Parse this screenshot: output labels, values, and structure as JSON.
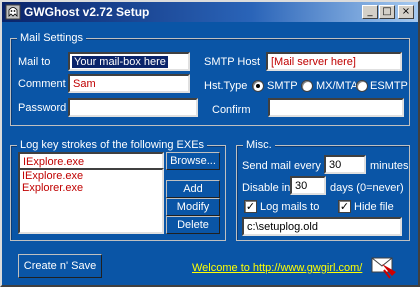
{
  "window": {
    "title": "GWGhost v2.72 Setup",
    "minimize_glyph": "_",
    "maximize_glyph": "□",
    "close_glyph": "×"
  },
  "mail_settings": {
    "legend": "Mail Settings",
    "mail_to_label": "Mail to",
    "mail_to_value": "Your mail-box here",
    "comment_label": "Comment",
    "comment_value": "Sam",
    "password_label": "Password",
    "password_value": "",
    "smtp_host_label": "SMTP Host",
    "smtp_host_value": "[Mail server here]",
    "host_type_label": "Hst.Type",
    "host_types": [
      {
        "label": "SMTP",
        "selected": true
      },
      {
        "label": "MX/MTA",
        "selected": false
      },
      {
        "label": "ESMTP",
        "selected": false
      }
    ],
    "confirm_label": "Confirm",
    "confirm_value": ""
  },
  "exe_group": {
    "legend": "Log key strokes of the following EXEs",
    "input_value": "IExplore.exe",
    "list_items": [
      "IExplore.exe",
      "Explorer.exe"
    ],
    "browse_label": "Browse...",
    "add_label": "Add",
    "modify_label": "Modify",
    "delete_label": "Delete"
  },
  "misc": {
    "legend": "Misc.",
    "send_every_label": "Send mail every",
    "send_every_value": "30",
    "send_every_unit": "minutes",
    "disable_label": "Disable in",
    "disable_value": "30",
    "disable_unit": "days (0=never)",
    "log_mails_label": "Log mails to",
    "log_mails_checked": true,
    "hide_file_label": "Hide file",
    "hide_file_checked": true,
    "log_path_value": "c:\\setuplog.old"
  },
  "footer": {
    "create_save_label": "Create n' Save",
    "welcome_link": "Welcome to http://www.gwgirl.com/"
  },
  "colors": {
    "background": "#0a55a6",
    "field_text": "#c00000",
    "link": "#ffff00"
  }
}
